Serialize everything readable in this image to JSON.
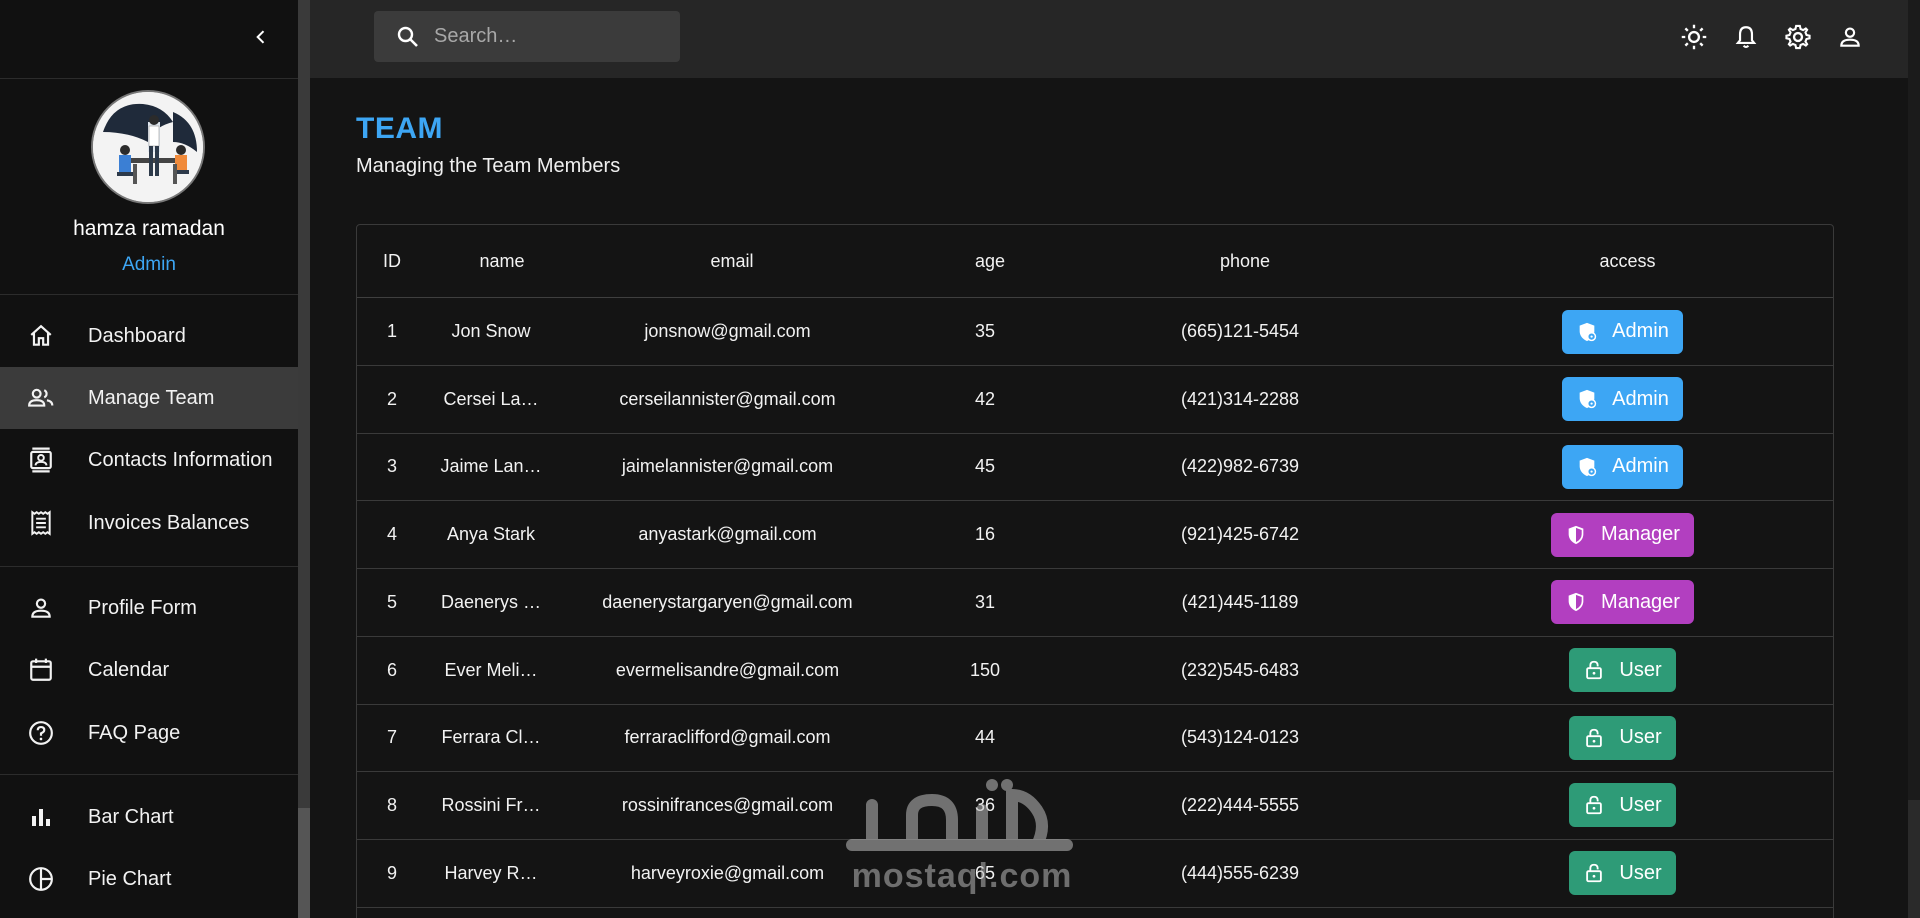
{
  "sidebar": {
    "user": {
      "name": "hamza ramadan",
      "role": "Admin"
    },
    "nav_groups": [
      [
        {
          "label": "Dashboard",
          "icon": "home-icon"
        },
        {
          "label": "Manage Team",
          "icon": "people-icon",
          "active": true
        },
        {
          "label": "Contacts Information",
          "icon": "contacts-icon"
        },
        {
          "label": "Invoices Balances",
          "icon": "receipt-icon"
        }
      ],
      [
        {
          "label": "Profile Form",
          "icon": "person-icon"
        },
        {
          "label": "Calendar",
          "icon": "calendar-icon"
        },
        {
          "label": "FAQ Page",
          "icon": "help-icon"
        }
      ],
      [
        {
          "label": "Bar Chart",
          "icon": "bar-chart-icon"
        },
        {
          "label": "Pie Chart",
          "icon": "pie-chart-icon"
        }
      ]
    ]
  },
  "topbar": {
    "search": {
      "placeholder": "Search…",
      "value": ""
    },
    "icons": [
      "light-mode-icon",
      "notifications-icon",
      "settings-icon",
      "account-icon"
    ]
  },
  "page": {
    "title": "TEAM",
    "subtitle": "Managing the Team Members"
  },
  "table": {
    "columns": [
      "ID",
      "name",
      "email",
      "age",
      "phone",
      "access"
    ],
    "rows": [
      {
        "id": "1",
        "name": "Jon Snow",
        "email": "jonsnow@gmail.com",
        "age": "35",
        "phone": "(665)121-5454",
        "access": "Admin"
      },
      {
        "id": "2",
        "name": "Cersei La…",
        "email": "cerseilannister@gmail.com",
        "age": "42",
        "phone": "(421)314-2288",
        "access": "Admin"
      },
      {
        "id": "3",
        "name": "Jaime Lan…",
        "email": "jaimelannister@gmail.com",
        "age": "45",
        "phone": "(422)982-6739",
        "access": "Admin"
      },
      {
        "id": "4",
        "name": "Anya Stark",
        "email": "anyastark@gmail.com",
        "age": "16",
        "phone": "(921)425-6742",
        "access": "Manager"
      },
      {
        "id": "5",
        "name": "Daenerys …",
        "email": "daenerystargaryen@gmail.com",
        "age": "31",
        "phone": "(421)445-1189",
        "access": "Manager"
      },
      {
        "id": "6",
        "name": "Ever Meli…",
        "email": "evermelisandre@gmail.com",
        "age": "150",
        "phone": "(232)545-6483",
        "access": "User"
      },
      {
        "id": "7",
        "name": "Ferrara Cl…",
        "email": "ferraraclifford@gmail.com",
        "age": "44",
        "phone": "(543)124-0123",
        "access": "User"
      },
      {
        "id": "8",
        "name": "Rossini Fr…",
        "email": "rossinifrances@gmail.com",
        "age": "36",
        "phone": "(222)444-5555",
        "access": "User"
      },
      {
        "id": "9",
        "name": "Harvey R…",
        "email": "harveyroxie@gmail.com",
        "age": "65",
        "phone": "(444)555-6239",
        "access": "User"
      }
    ]
  },
  "colors": {
    "accent": "#3da6f4",
    "admin": "#3da6f4",
    "manager": "#b23fc0",
    "user": "#2e9b77"
  },
  "watermark": {
    "arabic": "مستقل",
    "latin": "mostaql.com"
  }
}
